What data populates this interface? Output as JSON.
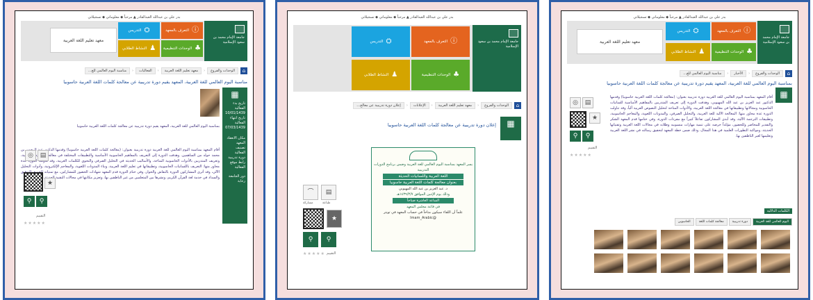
{
  "header": {
    "top_links": "بدر علي بن عبدالله العبدالقادر   ▲ مرحباً   ◆ معلوماتي   ◆ تسجيلاتي",
    "university": "جامعة الإمام محمد بن سعود الإسلامية",
    "tiles": {
      "teaching": "التدريس",
      "identification": "التعرف بالمعهد",
      "units": "الوحدات التنظيمية",
      "activities": "النشاط الطلابي",
      "institute": "معهد تعليم اللغة العربية"
    }
  },
  "screens": [
    {
      "breadcrumb": [
        "الوحدات والفروع",
        "معهد تعليم اللغة العربية",
        "الفعاليات",
        "مناسبة اليوم العالمي للغ..."
      ],
      "title": "مناسبة اليوم العالمي للغة العربية، المعهد يقيم دورة تدريبية عن معالجة كلمات اللغة العربية حاسوبيا",
      "side": {
        "start_label": "تاريخ بدء الفعالية",
        "start_date": "10/01/1439",
        "end_label": "تاريخ انتهاء الفعالية",
        "end_date": "07/03/1439",
        "place_label": "مكان الانعقاد",
        "place": "المعهد",
        "type_label": "تصنيف الفعالية",
        "type": "دورة تدريبية",
        "site_label": "رابط موقع الفعالية",
        "org_label": "دور الجامعة",
        "org": "رعاية"
      },
      "summary": "بمناسبة اليوم العالمي للغة العربية، المعهد يقيم دورة تدريبية عن معالجة كلمات اللغة العربية حاسوبيا",
      "body": "أقام المعهد بمناسبة اليوم العالمي للغة العربية دورة تدريبية بعنوان: (معالجة كلمات اللغة العربية حاسوبيا) وقدمها الدكتور عبد الرحمن بن محمد حوله من الساهمين. وهدفت الدورة إلى التعريف بالمفاهيم الحاسوبية الأساسية والتطبيقات المختلفة في معالجة النصوص العربية، وتعريف المتدربين بالأدوات الحاسوبية المتاحة، والأساليب الحديثة في التحليل الصرفي والنحوي للكلمات العربية، وقد تناولت الدورة عدة محاور منها: التعريف باللسانيات الحاسوبية، وتطبيقاتها في تعليم اللغة العربية، وبناء المدونات اللغوية، والمعاجم الإلكترونية، وأدوات التحليل الآلي، وقد أثرى المشاركون الدورة بالنقاش والحوار، وفي ختام الدورة قدم المعهد شهادات الحضور للمشاركين، مع تمنياته للجميع بالتوفيق والسداد في خدمة لغة القرآن الكريم، ونشرها بين المتعلمين من غير الناطقين بها، وتعزيز مكانتها في مجالات التقنية الحديثة.",
      "rating_label": "التقييم",
      "stars": "★★★★★"
    },
    {
      "breadcrumb": [
        "الوحدات والفروع",
        "معهد تعليم اللغة العربية",
        "الإعلانات",
        "إعلان دورة تدريبية عن معالج..."
      ],
      "title": "إعلان دورة تدريبية عن معالجة كلمات اللغة العربية حاسوبيا",
      "poster": {
        "line1": "يسر المعهد بمناسبة اليوم العالمي للغة العربية وضمن برنامج الدورات التدريبية",
        "line2": "اللغة العربية واللسانيات الحديثة",
        "line3": "بعنوان معالجة كلمات اللغة العربية حاسوبيا",
        "line4": "د. عبد العزيز بن عبد الله المهيوبي",
        "line5": "وذلك يوم الإثنين الموافق ١٤٣٩/٣/٧هـ",
        "line6": "الساعة العاشرة صباحاً",
        "line7": "في قاعة مجلس المعهد",
        "line8": "علماً أن اللقاء سيكون متاحاً في حساب المعهد في تويتر",
        "twitter": "@Imam_Arabic"
      },
      "share_label": "مشاركة",
      "print_label": "طباعة",
      "rating_label": "التقييم",
      "stars": "★★★★★"
    },
    {
      "breadcrumb": [
        "الوحدات والفروع",
        "الأخبار",
        "مناسبة اليوم العالمي للغ..."
      ],
      "title": "بمناسبة اليوم العالمي للغة العربية، المعهد يقيم دورة تدريبية عن معالجة كلمات اللغة العربية حاسوبيا",
      "body": "أقام المعهد بمناسبة اليوم العالمي للغة العربية دورة تدريبية بعنوان: (معالجة كلمات اللغة العربية حاسوبيا) وقدمها الدكتور عبد العزيز بن عبد الله المهيوبي، وهدفت الدورة إلى تعريف المتدربين بالمفاهيم الأساسية للسانيات الحاسوبية ومجالاتها وتطبيقاتها في معالجة اللغة العربية، والأدوات المتاحة لتحليل النصوص العربية آلياً، وقد تناولت الدورة عدة محاور منها: المعالجة الآلية للغة العربية، والتحليل الصرفي، والمدونات اللغوية، والمعاجم الحاسوبية، وتطبيقات الترجمة الآلية، وقد أبدى المشاركون تفاعلاً كبيراً مع مفردات الدورة، وفي ختامها قدم المعهد الشكر والتقدير للمحاضر وللحضور، مؤكداً حرصه على تنمية مهارات منسوبيه وطلابه في مجالات اللغة العربية وتقنياتها الحديثة، ومواكبة التطورات العلمية في هذا المجال، وذلك ضمن خطة المعهد لتحقيق رسالته في نشر اللغة العربية وتعليمها لغير الناطقين بها.",
      "keywords_label": "الكلمات الدلالية",
      "tabs": [
        "اليوم العالمي للغة العربية",
        "دورة تدريبية",
        "معالجة كلمات اللغة",
        "الحاسوبي"
      ],
      "rating_label": "التقييم",
      "stars": "★★★★★"
    }
  ]
}
